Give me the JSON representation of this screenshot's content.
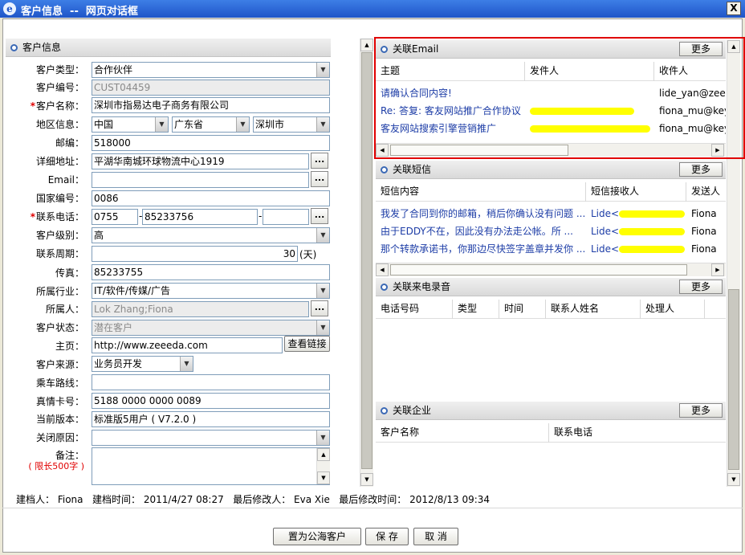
{
  "window": {
    "title": "客户信息  --  网页对话框",
    "close": "X"
  },
  "left_panel": {
    "header": "客户信息",
    "fields": {
      "type": {
        "label": "客户类型：",
        "value": "合作伙伴"
      },
      "code": {
        "label": "客户编号：",
        "value": "CUST04459"
      },
      "name": {
        "label": "客户名称：",
        "value": "深圳市指易达电子商务有限公司"
      },
      "region": {
        "label": "地区信息：",
        "country": "中国",
        "province": "广东省",
        "city": "深圳市"
      },
      "zip": {
        "label": "邮编：",
        "value": "518000"
      },
      "address": {
        "label": "详细地址：",
        "value": "平湖华南城环球物流中心1919"
      },
      "email": {
        "label": "Email：",
        "value": ""
      },
      "country_code": {
        "label": "国家编号：",
        "value": "0086"
      },
      "phone": {
        "label": "联系电话：",
        "area": "0755",
        "number": "85233756",
        "ext": ""
      },
      "level": {
        "label": "客户级别：",
        "value": "高"
      },
      "cycle": {
        "label": "联系周期：",
        "value": "30",
        "unit": "(天)"
      },
      "fax": {
        "label": "传真：",
        "value": "85233755"
      },
      "industry": {
        "label": "所属行业：",
        "value": "IT/软件/传媒/广告"
      },
      "owner": {
        "label": "所属人：",
        "value": "Lok Zhang;Fiona"
      },
      "status": {
        "label": "客户状态：",
        "value": "潜在客户"
      },
      "homepage": {
        "label": "主页：",
        "value": "http://www.zeeeda.com",
        "button": "查看链接"
      },
      "source": {
        "label": "客户来源：",
        "value": "业务员开发"
      },
      "route": {
        "label": "乘车路线：",
        "value": ""
      },
      "card": {
        "label": "真情卡号：",
        "value": "5188 0000 0000 0089"
      },
      "version": {
        "label": "当前版本：",
        "value": "标准版5用户 ( V7.2.0 )"
      },
      "close_reason": {
        "label": "关闭原因：",
        "value": ""
      },
      "remark": {
        "label": "备注：",
        "limit": "( 限长500字 )",
        "value": ""
      }
    },
    "dots_button": "..."
  },
  "email_panel": {
    "header": "关联Email",
    "more": "更多",
    "columns": [
      "主题",
      "发件人",
      "收件人"
    ],
    "rows": [
      {
        "subject": "请确认合同内容!",
        "sender": "",
        "recipient": "lide_yan@zeee"
      },
      {
        "subject": "Re: 答复: 客友网站推广合作协议",
        "sender": "…@…;",
        "recipient": "fiona_mu@key"
      },
      {
        "subject": "客友网站搜索引擎营销推广",
        "sender": "…@….com",
        "recipient": "fiona_mu@key"
      }
    ]
  },
  "sms_panel": {
    "header": "关联短信",
    "more": "更多",
    "columns": [
      "短信内容",
      "短信接收人",
      "发送人"
    ],
    "rows": [
      {
        "content": "我发了合同到你的邮箱，稍后你确认没有问题 ...",
        "recipient": "Lide<",
        "sender": "Fiona"
      },
      {
        "content": "由于EDDY不在，因此没有办法走公帐。所 ...",
        "recipient": "Lide<",
        "sender": "Fiona"
      },
      {
        "content": "那个转款承诺书，你那边尽快签字盖章并发你 ...",
        "recipient": "Lide<",
        "sender": "Fiona"
      }
    ]
  },
  "call_panel": {
    "header": "关联来电录音",
    "more": "更多",
    "columns": [
      "电话号码",
      "类型",
      "时间",
      "联系人姓名",
      "处理人"
    ]
  },
  "company_panel": {
    "header": "关联企业",
    "more": "更多",
    "columns": [
      "客户名称",
      "联系电话"
    ]
  },
  "info": {
    "creator_label": "建档人：",
    "creator": "Fiona",
    "created_label": "建档时间：",
    "created": "2011/4/27 08:27",
    "modifier_label": "最后修改人：",
    "modifier": "Eva Xie",
    "modified_label": "最后修改时间：",
    "modified": "2012/8/13 09:34"
  },
  "buttons": {
    "public": "置为公海客户",
    "save": "保 存",
    "cancel": "取 消"
  },
  "colors": {
    "titlebar": "#2a63d4",
    "link": "#1c3ca6",
    "required": "#e00000",
    "highlight_box": "#e00000",
    "redaction": "#ffff00"
  }
}
